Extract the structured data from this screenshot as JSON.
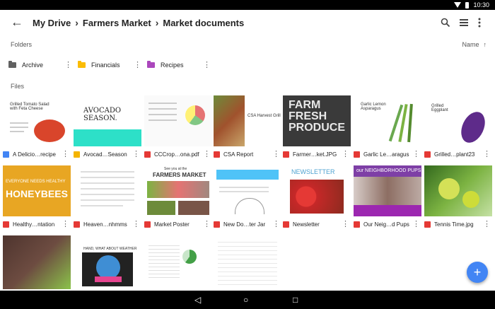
{
  "status": {
    "time": "10:30"
  },
  "breadcrumb": {
    "root": "My Drive",
    "middle": "Farmers Market",
    "current": "Market documents"
  },
  "sections": {
    "folders": "Folders",
    "files": "Files"
  },
  "sort": {
    "label": "Name",
    "arrow": "↑"
  },
  "folders": [
    {
      "name": "Archive",
      "color": "#616161"
    },
    {
      "name": "Financials",
      "color": "#fbbc05"
    },
    {
      "name": "Recipes",
      "color": "#ab47bc"
    }
  ],
  "files": [
    {
      "name": "A Delicio…recipe",
      "type": "doc",
      "icon": "doc-icon"
    },
    {
      "name": "Avocad…Season",
      "type": "slide",
      "icon": "slides-icon"
    },
    {
      "name": "CCCrop…ona.pdf",
      "type": "pdf",
      "icon": "pdf-icon"
    },
    {
      "name": "CSA Report",
      "type": "pdf",
      "icon": "pdf-icon"
    },
    {
      "name": "Farmer…ket.JPG",
      "type": "img",
      "icon": "image-icon"
    },
    {
      "name": "Garlic Le…aragus",
      "type": "pdf",
      "icon": "pdf-icon"
    },
    {
      "name": "Grilled…plant23",
      "type": "pdf",
      "icon": "pdf-icon"
    },
    {
      "name": "Healthy…ntation",
      "type": "pdf",
      "icon": "pdf-icon"
    },
    {
      "name": "Heaven…nhmms",
      "type": "pdf",
      "icon": "pdf-icon"
    },
    {
      "name": "Market Poster",
      "type": "pdf",
      "icon": "pdf-icon"
    },
    {
      "name": "New Do…ter Jar",
      "type": "pdf",
      "icon": "pdf-icon"
    },
    {
      "name": "Newsletter",
      "type": "pdf",
      "icon": "pdf-icon"
    },
    {
      "name": "Our Neig…d Pups",
      "type": "pdf",
      "icon": "pdf-icon"
    },
    {
      "name": "Tennis Time.jpg",
      "type": "img",
      "icon": "image-icon"
    }
  ],
  "thumbnails": {
    "t1_title": "Grilled Tomato Salad with Feta Cheese",
    "t2_title": "AVOCADO SEASON.",
    "t4_title": "CSA Harvest Grill",
    "t5_text": "FARM FRESH PRODUCE",
    "t6_title": "Garlic Lemon Asparagus",
    "t7_title": "Grilled Eggplant",
    "t8_text": "HONEYBEES",
    "t8_top": "EVERYONE NEEDS HEALTHY",
    "t10_top": "See you at the",
    "t10_title": "FARMERS MARKET",
    "t12_title": "NEWSLETTER",
    "t13_title": "our NEIGHBORHOOD PUPS",
    "t16_title": "HAND, WHAT ABOUT WEATHER"
  }
}
